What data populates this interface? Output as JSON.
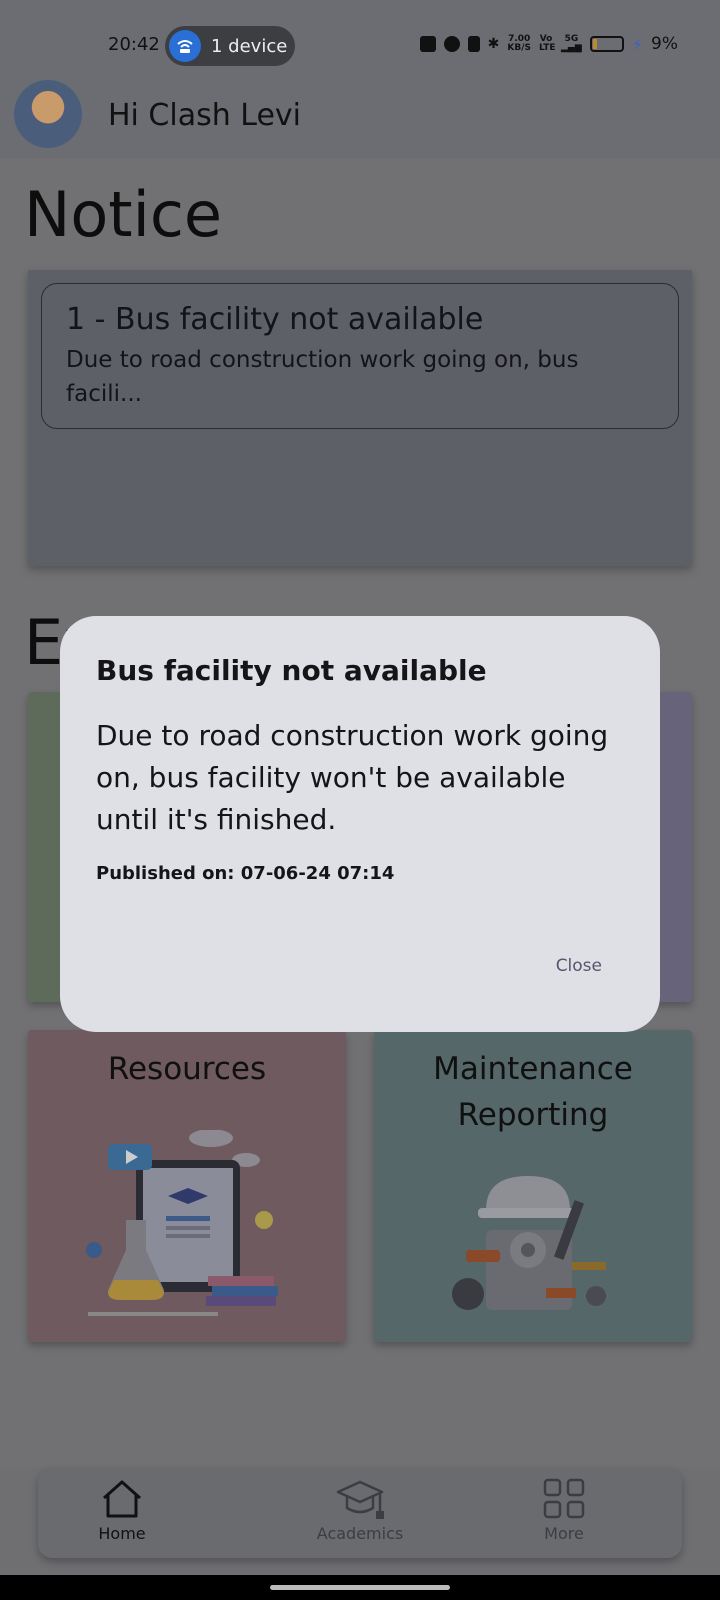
{
  "status_bar": {
    "time": "20:42",
    "hotspot_label": "1 device",
    "net_speed_value": "7.00",
    "net_speed_unit": "KB/S",
    "volte": "Vo LTE",
    "signal": "5G",
    "battery_percent": "9%"
  },
  "header": {
    "greeting": "Hi Clash Levi"
  },
  "notice": {
    "section_title": "Notice",
    "items": [
      {
        "title": "1 - Bus facility not available",
        "preview": "Due to road construction work going on, bus facili..."
      }
    ]
  },
  "explore": {
    "section_title_partial": "Ex"
  },
  "tiles": [
    {
      "title": "Resources",
      "color": "#6e5a5f"
    },
    {
      "title": "Maintenance Reporting",
      "color": "#56676a"
    }
  ],
  "bottom_nav": [
    {
      "label": "Home",
      "icon": "home-icon",
      "active": true
    },
    {
      "label": "Academics",
      "icon": "graduation-cap-icon",
      "active": false
    },
    {
      "label": "More",
      "icon": "grid-icon",
      "active": false
    }
  ],
  "dialog": {
    "title": "Bus facility not available",
    "body": "Due to road construction work going on, bus facility won't be available until it's finished.",
    "published": "Published on: 07-06-24 07:14",
    "close_label": "Close"
  },
  "colors": {
    "dialog_bg": "#dfe0e6",
    "scrim": "#6f6f72",
    "accent_blue": "#2a6fd6"
  }
}
